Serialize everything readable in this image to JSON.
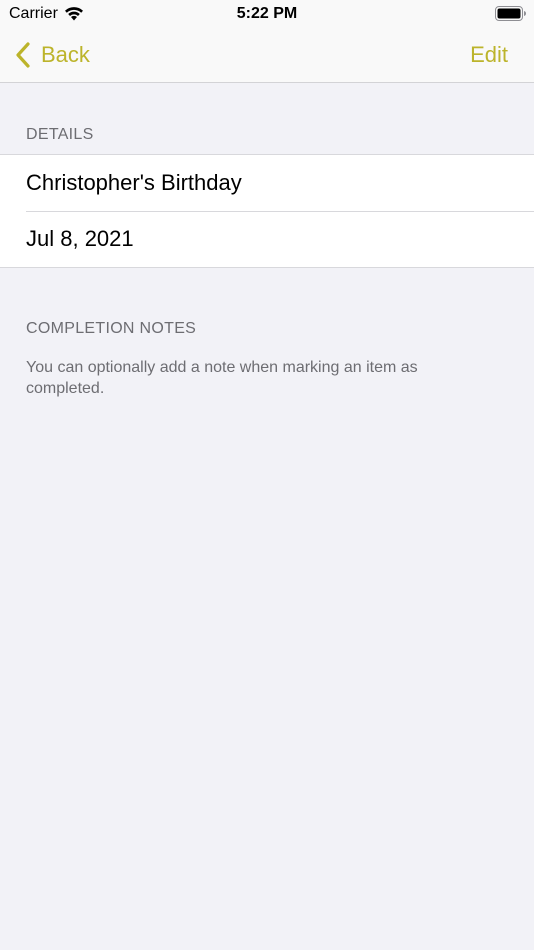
{
  "status_bar": {
    "carrier": "Carrier",
    "time": "5:22 PM",
    "wifi_icon": "wifi-icon",
    "battery_icon": "battery-icon"
  },
  "nav": {
    "back_label": "Back",
    "edit_label": "Edit",
    "tint_color": "#bcb42b",
    "back_icon": "chevron-left-icon"
  },
  "details": {
    "header": "DETAILS",
    "title": "Christopher's Birthday",
    "date": "Jul 8, 2021"
  },
  "completion_notes": {
    "header": "COMPLETION NOTES",
    "footer": "You can optionally add a note when marking an item as completed."
  }
}
